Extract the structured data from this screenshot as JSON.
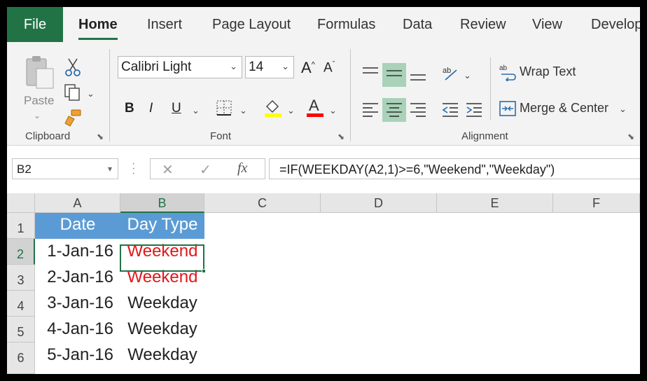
{
  "tabs": {
    "file": "File",
    "items": [
      "Home",
      "Insert",
      "Page Layout",
      "Formulas",
      "Data",
      "Review",
      "View",
      "Develop"
    ]
  },
  "ribbon": {
    "clipboard": {
      "paste_label": "Paste",
      "group_label": "Clipboard"
    },
    "font": {
      "font_name": "Calibri Light",
      "font_size": "14",
      "bold": "B",
      "italic": "I",
      "underline": "U",
      "font_color_letter": "A",
      "group_label": "Font"
    },
    "alignment": {
      "wrap_text": "Wrap Text",
      "merge_center": "Merge & Center",
      "group_label": "Alignment"
    }
  },
  "formula_bar": {
    "name_box": "B2",
    "fx_label": "fx",
    "formula": "=IF(WEEKDAY(A2,1)>=6,\"Weekend\",\"Weekday\")"
  },
  "grid": {
    "columns": [
      "A",
      "B",
      "C",
      "D",
      "E",
      "F"
    ],
    "rows": [
      "1",
      "2",
      "3",
      "4",
      "5",
      "6"
    ],
    "header": [
      "Date",
      "Day Type"
    ],
    "data": [
      [
        "1-Jan-16",
        "Weekend"
      ],
      [
        "2-Jan-16",
        "Weekend"
      ],
      [
        "3-Jan-16",
        "Weekday"
      ],
      [
        "4-Jan-16",
        "Weekday"
      ],
      [
        "5-Jan-16",
        "Weekday"
      ]
    ],
    "selected_cell": "B2"
  },
  "colors": {
    "accent_green": "#217346",
    "header_fill": "#5b9bd5",
    "weekend_text": "#e0181b",
    "highlight_yellow": "#ffff00",
    "font_color_red": "#ff0000"
  }
}
